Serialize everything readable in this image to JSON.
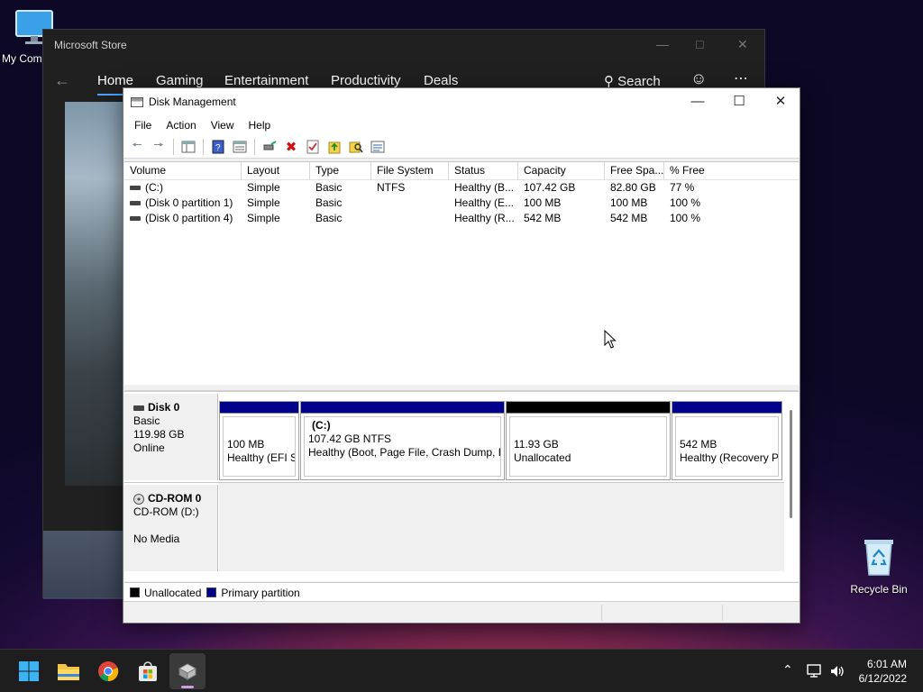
{
  "desktop": {
    "icons": [
      {
        "label": "My Com"
      },
      {
        "label": "Recycle Bin"
      }
    ]
  },
  "store": {
    "title": "Microsoft Store",
    "tabs": [
      "Home",
      "Gaming",
      "Entertainment",
      "Productivity",
      "Deals"
    ],
    "search_label": "Search"
  },
  "disk_mgmt": {
    "title": "Disk Management",
    "menu": [
      "File",
      "Action",
      "View",
      "Help"
    ],
    "columns": [
      "Volume",
      "Layout",
      "Type",
      "File System",
      "Status",
      "Capacity",
      "Free Spa...",
      "% Free"
    ],
    "volumes": [
      {
        "volume": "(C:)",
        "layout": "Simple",
        "type": "Basic",
        "fs": "NTFS",
        "status": "Healthy (B...",
        "capacity": "107.42 GB",
        "free": "82.80 GB",
        "pct": "77 %"
      },
      {
        "volume": "(Disk 0 partition 1)",
        "layout": "Simple",
        "type": "Basic",
        "fs": "",
        "status": "Healthy (E...",
        "capacity": "100 MB",
        "free": "100 MB",
        "pct": "100 %"
      },
      {
        "volume": "(Disk 0 partition 4)",
        "layout": "Simple",
        "type": "Basic",
        "fs": "",
        "status": "Healthy (R...",
        "capacity": "542 MB",
        "free": "542 MB",
        "pct": "100 %"
      }
    ],
    "disks": [
      {
        "name": "Disk 0",
        "type": "Basic",
        "size": "119.98 GB",
        "state": "Online",
        "partitions": [
          {
            "title": "",
            "line1": "100 MB",
            "line2": "Healthy (EFI Sy",
            "kind": "primary"
          },
          {
            "title": "(C:)",
            "line1": "107.42 GB NTFS",
            "line2": "Healthy (Boot, Page File, Crash Dump, B",
            "kind": "primary"
          },
          {
            "title": "",
            "line1": "11.93 GB",
            "line2": "Unallocated",
            "kind": "unallocated"
          },
          {
            "title": "",
            "line1": "542 MB",
            "line2": "Healthy (Recovery Pa",
            "kind": "primary"
          }
        ]
      },
      {
        "name": "CD-ROM 0",
        "type": "CD-ROM (D:)",
        "media": "No Media"
      }
    ],
    "legend": [
      {
        "label": "Unallocated",
        "color": "#000000"
      },
      {
        "label": "Primary partition",
        "color": "#00008b"
      }
    ]
  },
  "taskbar": {
    "clock_time": "6:01 AM",
    "clock_date": "6/12/2022"
  },
  "colors": {
    "primary_partition": "#00008b",
    "unallocated": "#000000",
    "store_accent": "#4da3ff"
  }
}
